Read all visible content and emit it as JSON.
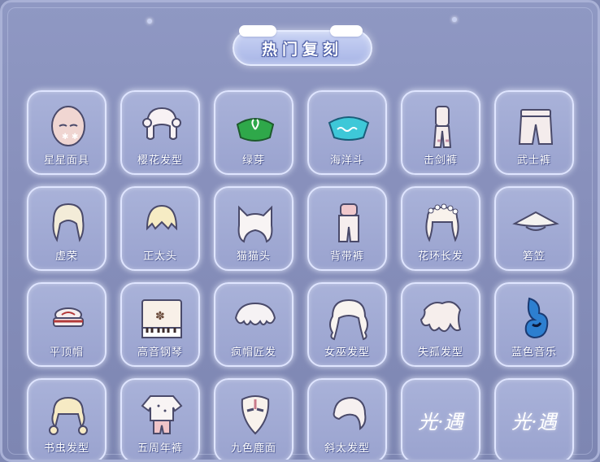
{
  "header": {
    "title": "热门复刻"
  },
  "items": [
    {
      "label": "星星面具",
      "icon": "star-mask-icon"
    },
    {
      "label": "樱花发型",
      "icon": "sakura-hair-icon"
    },
    {
      "label": "绿芽",
      "icon": "green-sprout-cape-icon"
    },
    {
      "label": "海洋斗",
      "icon": "ocean-cape-icon"
    },
    {
      "label": "击剑裤",
      "icon": "fencing-pants-icon"
    },
    {
      "label": "武士裤",
      "icon": "samurai-pants-icon"
    },
    {
      "label": "虚荣",
      "icon": "vanity-hair-icon"
    },
    {
      "label": "正太头",
      "icon": "boy-hair-icon"
    },
    {
      "label": "猫猫头",
      "icon": "cat-hair-icon"
    },
    {
      "label": "背带裤",
      "icon": "overalls-icon"
    },
    {
      "label": "花环长发",
      "icon": "flower-crown-hair-icon"
    },
    {
      "label": "箬笠",
      "icon": "bamboo-hat-icon"
    },
    {
      "label": "平顶帽",
      "icon": "flat-cap-icon"
    },
    {
      "label": "高音钢琴",
      "icon": "piano-icon"
    },
    {
      "label": "疯帽匠发",
      "icon": "mad-hatter-hair-icon"
    },
    {
      "label": "女巫发型",
      "icon": "witch-hair-icon"
    },
    {
      "label": "失孤发型",
      "icon": "lost-hair-icon"
    },
    {
      "label": "蓝色音乐",
      "icon": "blue-music-icon"
    },
    {
      "label": "书虫发型",
      "icon": "bookworm-hair-icon"
    },
    {
      "label": "五周年裤",
      "icon": "fifth-anniversary-outfit-icon"
    },
    {
      "label": "九色鹿面",
      "icon": "nine-color-deer-mask-icon"
    },
    {
      "label": "斜太发型",
      "icon": "side-hair-icon"
    },
    {
      "label": "光·遇",
      "icon": "sky-logo"
    },
    {
      "label": "光·遇",
      "icon": "sky-logo"
    }
  ]
}
